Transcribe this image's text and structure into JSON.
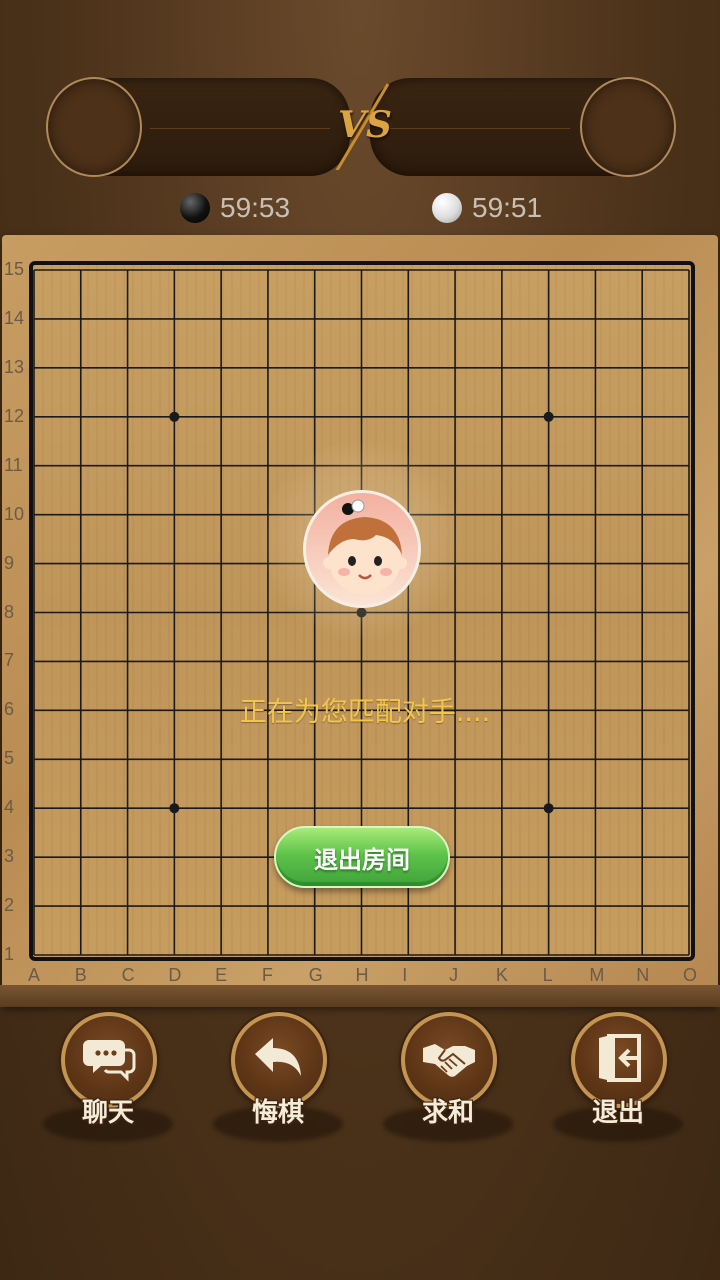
{
  "players": {
    "left_timer": "59:53",
    "right_timer": "59:51",
    "vs_label": "VS"
  },
  "board": {
    "size": 15,
    "columns": [
      "A",
      "B",
      "C",
      "D",
      "E",
      "F",
      "G",
      "H",
      "I",
      "J",
      "K",
      "L",
      "M",
      "N",
      "O"
    ],
    "rows": [
      "15",
      "14",
      "13",
      "12",
      "11",
      "10",
      "9",
      "8",
      "7",
      "6",
      "5",
      "4",
      "3",
      "2",
      "1"
    ],
    "star_points": [
      "D12",
      "L12",
      "H8",
      "D4",
      "L4"
    ]
  },
  "matching": {
    "status_text": "正在为您匹配对手....",
    "exit_room_label": "退出房间"
  },
  "actions": [
    {
      "label": "聊天",
      "icon": "chat-bubbles-icon"
    },
    {
      "label": "悔棋",
      "icon": "undo-arrow-icon"
    },
    {
      "label": "求和",
      "icon": "handshake-icon"
    },
    {
      "label": "退出",
      "icon": "exit-door-icon"
    }
  ],
  "colors": {
    "accent_text": "#f2c64a",
    "button_green": "#5fc44a",
    "board_line": "#1a1a1a",
    "frame_gold": "#c49452"
  }
}
